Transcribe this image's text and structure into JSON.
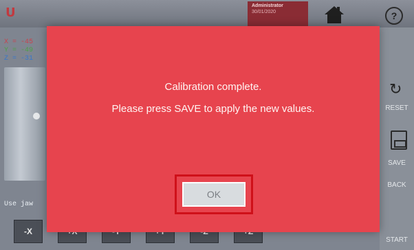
{
  "header": {
    "logo_text": "U",
    "user_role": "Administrator",
    "date": "30/01/2020",
    "home_icon": "home-icon",
    "help_label": "?"
  },
  "readouts": {
    "x": "X = -45",
    "y": "Y = -49",
    "z": "Z = -31"
  },
  "hint_text": "Use jaw",
  "sidebar": {
    "reset_label": "RESET",
    "save_label": "SAVE",
    "back_label": "BACK",
    "start_label": "START"
  },
  "jog_buttons": [
    "-X",
    "+X",
    "-Y",
    "+Y",
    "-Z",
    "+Z"
  ],
  "dialog": {
    "line1": "Calibration complete.",
    "line2": "Please press SAVE to apply the new values.",
    "ok_label": "OK"
  },
  "colors": {
    "dialog_bg": "#e7444e",
    "highlight": "#cf1019",
    "brand": "#c2393f"
  }
}
